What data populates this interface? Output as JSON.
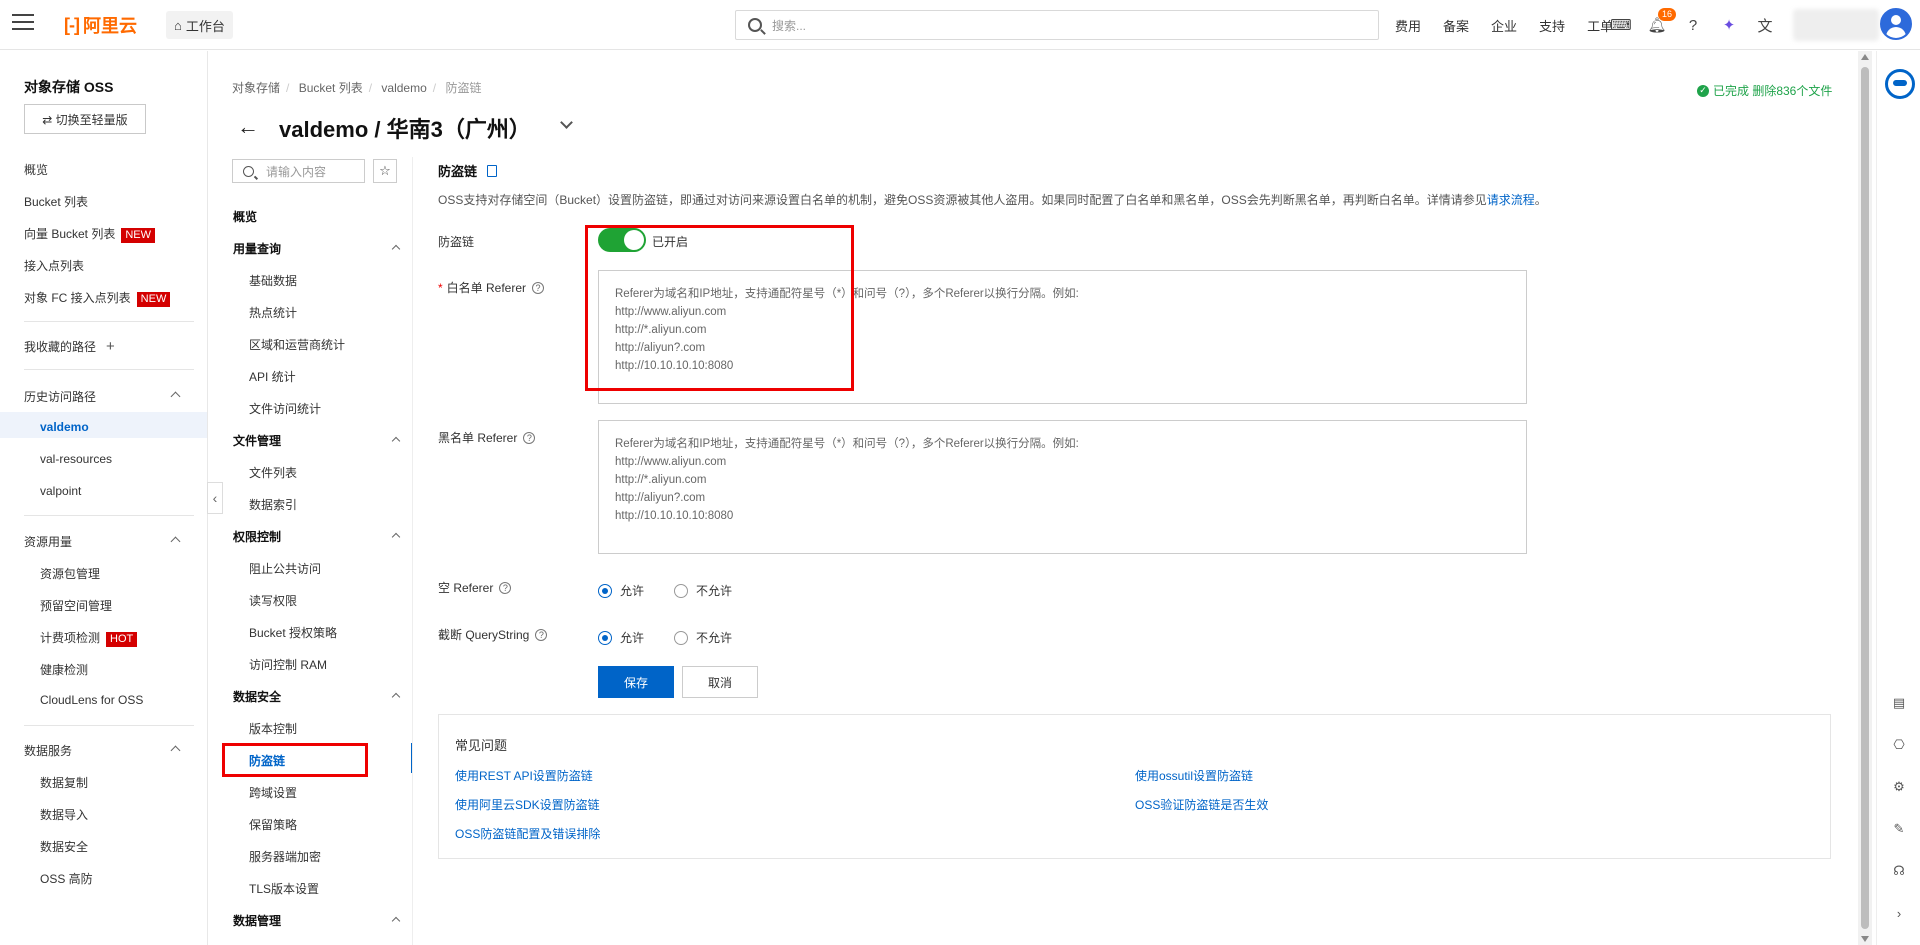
{
  "topbar": {
    "logo_text": "阿里云",
    "workbench": "工作台",
    "search_placeholder": "搜索...",
    "nav": [
      "费用",
      "备案",
      "企业",
      "支持",
      "工单"
    ],
    "notification_count": "16"
  },
  "sidebar": {
    "title": "对象存储 OSS",
    "switch_button": "⇄ 切换至轻量版",
    "items": [
      {
        "label": "概览"
      },
      {
        "label": "Bucket 列表"
      },
      {
        "label": "向量 Bucket 列表",
        "tag": "NEW"
      },
      {
        "label": "接入点列表"
      },
      {
        "label": "对象 FC 接入点列表",
        "tag": "NEW"
      }
    ],
    "favorites": "我收藏的路径",
    "history_title": "历史访问路径",
    "history": [
      "valdemo",
      "val-resources",
      "valpoint"
    ],
    "resource_title": "资源用量",
    "resource_items": [
      {
        "label": "资源包管理"
      },
      {
        "label": "预留空间管理"
      },
      {
        "label": "计费项检测",
        "tag": "HOT"
      },
      {
        "label": "健康检测"
      },
      {
        "label": "CloudLens for OSS"
      }
    ],
    "data_service_title": "数据服务",
    "data_service_items": [
      "数据复制",
      "数据导入",
      "数据安全",
      "OSS 高防"
    ]
  },
  "breadcrumb": [
    "对象存储",
    "Bucket 列表",
    "valdemo",
    "防盗链"
  ],
  "status": "已完成 删除836个文件",
  "page_title": "valdemo / 华南3（广州）",
  "secnav": {
    "search_placeholder": "请输入内容",
    "overview": "概览",
    "groups": [
      {
        "title": "用量查询",
        "items": [
          "基础数据",
          "热点统计",
          "区域和运营商统计",
          "API 统计",
          "文件访问统计"
        ]
      },
      {
        "title": "文件管理",
        "items": [
          "文件列表",
          "数据索引"
        ]
      },
      {
        "title": "权限控制",
        "items": [
          "阻止公共访问",
          "读写权限",
          "Bucket 授权策略",
          "访问控制 RAM"
        ]
      },
      {
        "title": "数据安全",
        "items": [
          "版本控制",
          "防盗链",
          "跨域设置",
          "保留策略",
          "服务器端加密",
          "TLS版本设置"
        ]
      },
      {
        "title": "数据管理",
        "items": []
      }
    ]
  },
  "content": {
    "heading": "防盗链",
    "desc": "OSS支持对存储空间（Bucket）设置防盗链，即通过对访问来源设置白名单的机制，避免OSS资源被其他人盗用。如果同时配置了白名单和黑名单，OSS会先判断黑名单，再判断白名单。详情请参见",
    "desc_link": "请求流程",
    "desc_end": "。",
    "hotlink_label": "防盗链",
    "hotlink_status": "已开启",
    "whitelist_label": "白名单 Referer",
    "blacklist_label": "黑名单 Referer",
    "referer_placeholder_lines": [
      "Referer为域名和IP地址，支持通配符星号（*）和问号（?），多个Referer以换行分隔。例如:",
      "http://www.aliyun.com",
      "http://*.aliyun.com",
      "http://aliyun?.com",
      "http://10.10.10.10:8080"
    ],
    "empty_referer_label": "空 Referer",
    "truncate_label": "截断 QueryString",
    "allow": "允许",
    "disallow": "不允许",
    "save": "保存",
    "cancel": "取消"
  },
  "faq": {
    "title": "常见问题",
    "links": [
      "使用REST API设置防盗链",
      "使用阿里云SDK设置防盗链",
      "OSS防盗链配置及错误排除",
      "使用ossutil设置防盗链",
      "OSS验证防盗链是否生效"
    ]
  },
  "colors": {
    "brand": "#ff6a00",
    "primary": "#0064c8",
    "toggle_on": "#1fa334",
    "highlight": "#ee0000"
  }
}
